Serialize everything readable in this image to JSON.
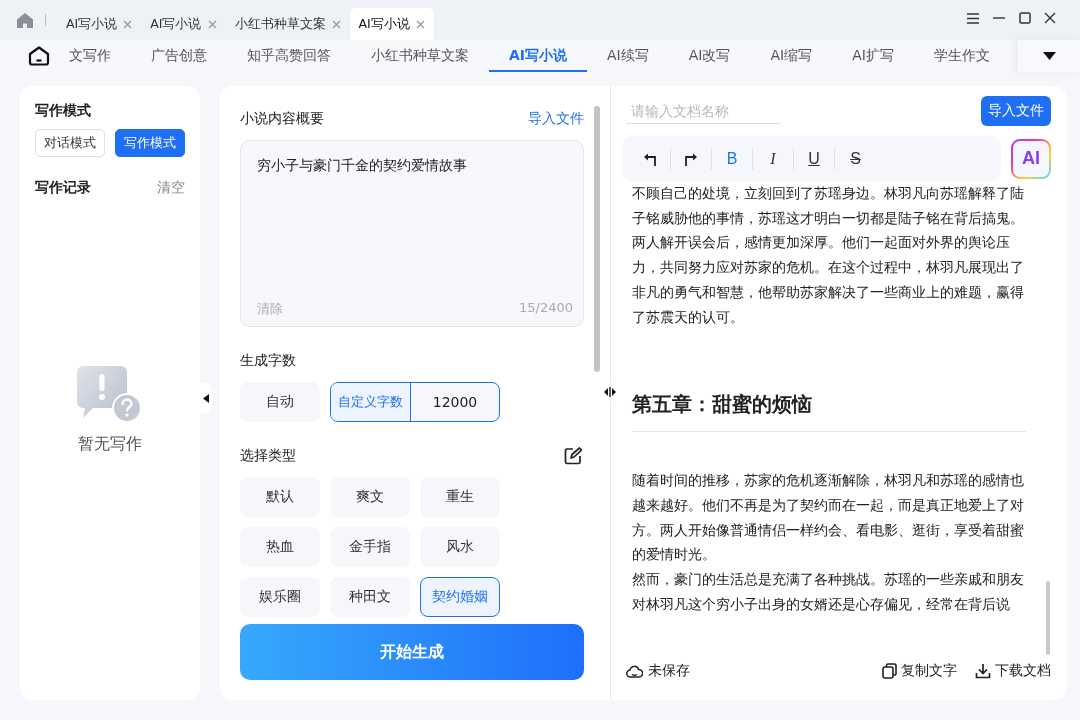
{
  "title_bar": {
    "tabs": [
      {
        "label": "AI写小说",
        "selected": false
      },
      {
        "label": "AI写小说",
        "selected": false
      },
      {
        "label": "小红书种草文案",
        "selected": false
      },
      {
        "label": "AI写小说",
        "selected": true
      }
    ]
  },
  "nav": {
    "items": [
      {
        "label": "文写作",
        "selected": false
      },
      {
        "label": "广告创意",
        "selected": false
      },
      {
        "label": "知乎高赞回答",
        "selected": false
      },
      {
        "label": "小红书种草文案",
        "selected": false
      },
      {
        "label": "AI写小说",
        "selected": true
      },
      {
        "label": "AI续写",
        "selected": false
      },
      {
        "label": "AI改写",
        "selected": false
      },
      {
        "label": "AI缩写",
        "selected": false
      },
      {
        "label": "AI扩写",
        "selected": false
      },
      {
        "label": "学生作文",
        "selected": false
      }
    ]
  },
  "sidebar": {
    "mode_title": "写作模式",
    "modes": [
      {
        "label": "对话模式",
        "selected": false
      },
      {
        "label": "写作模式",
        "selected": true
      }
    ],
    "history_title": "写作记录",
    "clear_label": "清空",
    "empty_text": "暂无写作"
  },
  "form": {
    "summary": {
      "label": "小说内容概要",
      "import_link": "导入文件",
      "value": "穷小子与豪门千金的契约爱情故事",
      "clear_label": "清除",
      "counter": "15/2400"
    },
    "word_count": {
      "label": "生成字数",
      "options": [
        {
          "label": "自动",
          "selected": false
        },
        {
          "label": "自定义字数",
          "selected": true,
          "value": "12000"
        }
      ]
    },
    "genre": {
      "label": "选择类型",
      "options": [
        {
          "label": "默认",
          "selected": false
        },
        {
          "label": "爽文",
          "selected": false
        },
        {
          "label": "重生",
          "selected": false
        },
        {
          "label": "热血",
          "selected": false
        },
        {
          "label": "金手指",
          "selected": false
        },
        {
          "label": "风水",
          "selected": false
        },
        {
          "label": "娱乐圈",
          "selected": false
        },
        {
          "label": "种田文",
          "selected": false
        },
        {
          "label": "契约婚姻",
          "selected": true
        }
      ]
    },
    "submit": "开始生成"
  },
  "editor": {
    "title_placeholder": "请输入文档名称",
    "import_button": "导入文件",
    "toolbar": [
      {
        "kind": "undo"
      },
      {
        "kind": "redo"
      },
      {
        "kind": "bold",
        "label": "B",
        "active": true
      },
      {
        "kind": "italic",
        "label": "I",
        "active": false
      },
      {
        "kind": "underline",
        "label": "U",
        "active": false
      },
      {
        "kind": "strike",
        "label": "S",
        "active": false
      }
    ],
    "ai_button": "AI",
    "content": [
      {
        "kind": "paragraph",
        "text": "不顾自己的处境，立刻回到了苏瑶身边。林羽凡向苏瑶解释了陆子铭威胁他的事情，苏瑶这才明白一切都是陆子铭在背后搞鬼。两人解开误会后，感情更加深厚。他们一起面对外界的舆论压力，共同努力应对苏家的危机。在这个过程中，林羽凡展现出了非凡的勇气和智慧，他帮助苏家解决了一些商业上的难题，赢得了苏震天的认可。"
      },
      {
        "kind": "heading",
        "text": "第五章：甜蜜的烦恼"
      },
      {
        "kind": "paragraph",
        "text": "随着时间的推移，苏家的危机逐渐解除，林羽凡和苏瑶的感情也越来越好。他们不再是为了契约而在一起，而是真正地爱上了对方。两人开始像普通情侣一样约会、看电影、逛街，享受着甜蜜的爱情时光。"
      },
      {
        "kind": "paragraph",
        "text": "然而，豪门的生活总是充满了各种挑战。苏瑶的一些亲戚和朋友对林羽凡这个穷小子出身的女婿还是心存偏见，经常在背后说"
      }
    ],
    "status": "未保存",
    "actions": [
      {
        "kind": "copy",
        "label": "复制文字"
      },
      {
        "kind": "download",
        "label": "下载文档"
      }
    ]
  }
}
